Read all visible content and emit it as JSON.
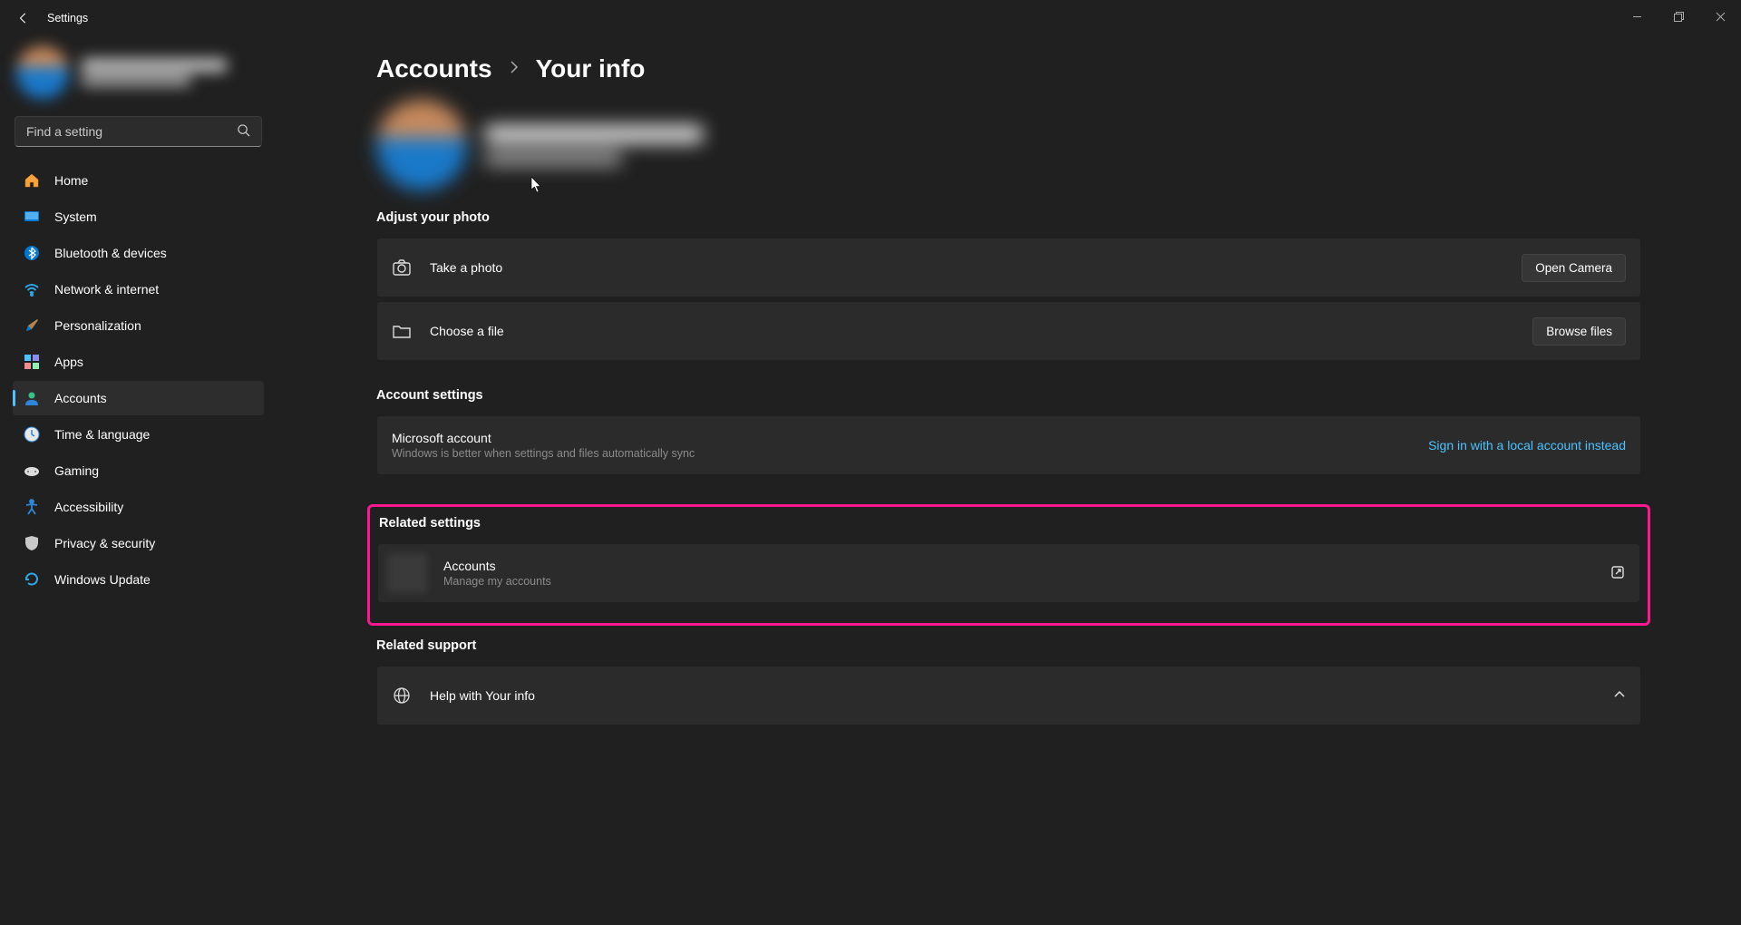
{
  "app": {
    "title": "Settings"
  },
  "search": {
    "placeholder": "Find a setting"
  },
  "nav": {
    "items": [
      {
        "label": "Home"
      },
      {
        "label": "System"
      },
      {
        "label": "Bluetooth & devices"
      },
      {
        "label": "Network & internet"
      },
      {
        "label": "Personalization"
      },
      {
        "label": "Apps"
      },
      {
        "label": "Accounts"
      },
      {
        "label": "Time & language"
      },
      {
        "label": "Gaming"
      },
      {
        "label": "Accessibility"
      },
      {
        "label": "Privacy & security"
      },
      {
        "label": "Windows Update"
      }
    ]
  },
  "breadcrumb": {
    "parent": "Accounts",
    "current": "Your info"
  },
  "sections": {
    "adjust_photo": {
      "title": "Adjust your photo",
      "take_photo": "Take a photo",
      "open_camera": "Open Camera",
      "choose_file": "Choose a file",
      "browse_files": "Browse files"
    },
    "account_settings": {
      "title": "Account settings",
      "ms_account": "Microsoft account",
      "ms_desc": "Windows is better when settings and files automatically sync",
      "local_link": "Sign in with a local account instead"
    },
    "related_settings": {
      "title": "Related settings",
      "accounts": "Accounts",
      "accounts_desc": "Manage my accounts"
    },
    "related_support": {
      "title": "Related support",
      "help": "Help with Your info"
    }
  }
}
